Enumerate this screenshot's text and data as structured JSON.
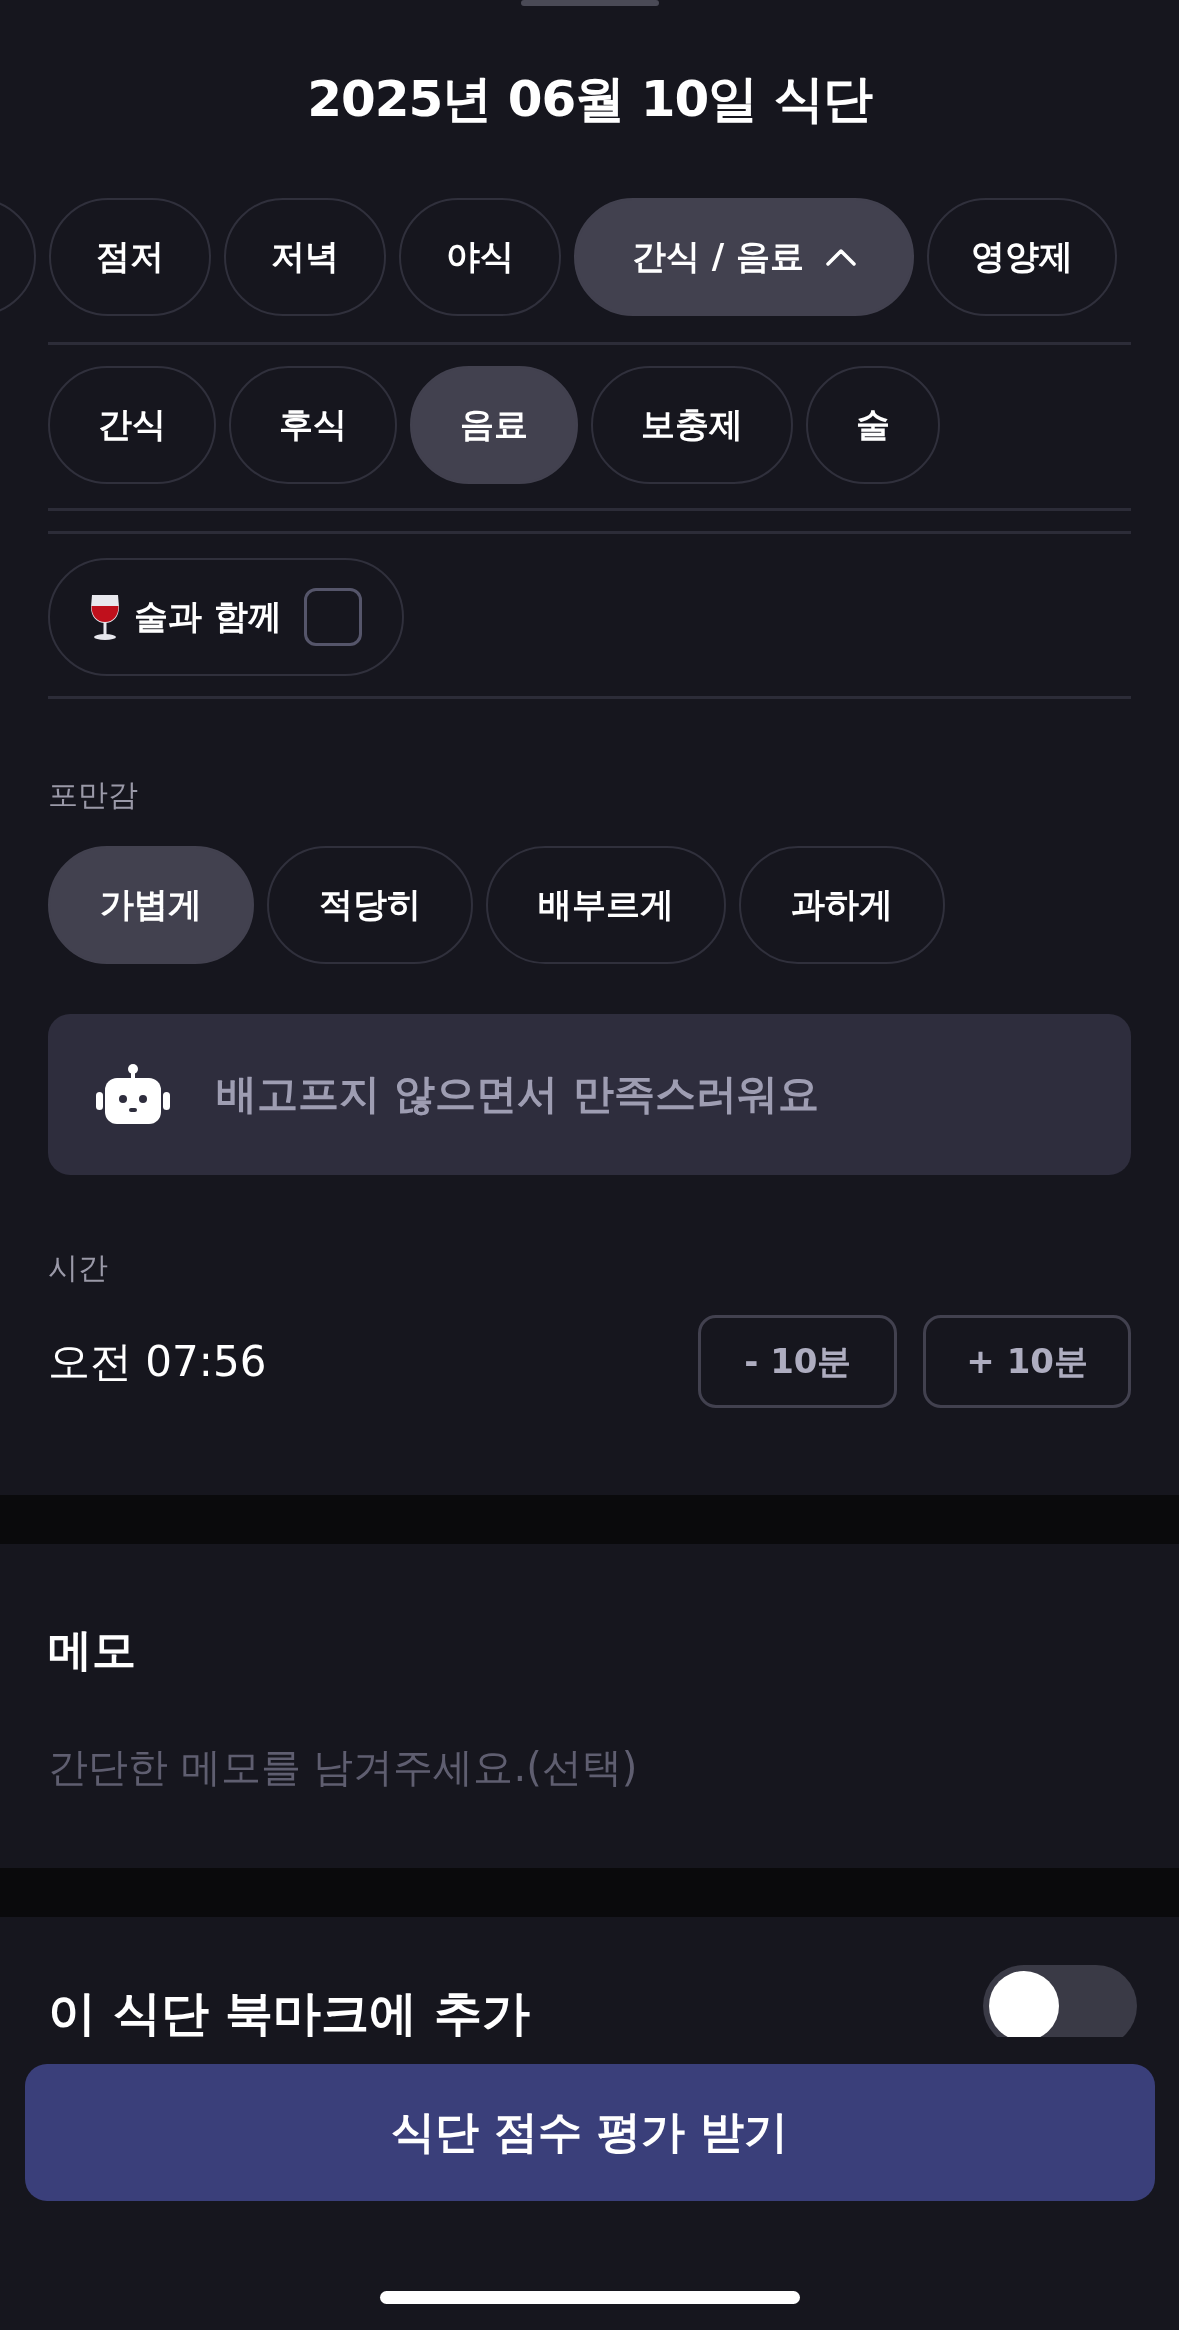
{
  "title": "2025년 06월 10일 식단",
  "meal_types": [
    {
      "label": "점저",
      "selected": false,
      "expanded": false
    },
    {
      "label": "저녁",
      "selected": false,
      "expanded": false
    },
    {
      "label": "야식",
      "selected": false,
      "expanded": false
    },
    {
      "label": "간식 / 음료",
      "selected": true,
      "expanded": true
    },
    {
      "label": "영양제",
      "selected": false,
      "expanded": false
    }
  ],
  "subtypes": [
    {
      "label": "간식",
      "selected": false
    },
    {
      "label": "후식",
      "selected": false
    },
    {
      "label": "음료",
      "selected": true
    },
    {
      "label": "보충제",
      "selected": false
    },
    {
      "label": "술",
      "selected": false
    }
  ],
  "with_alcohol": {
    "label": "술과 함께",
    "checked": false
  },
  "fullness": {
    "label": "포만감",
    "options": [
      {
        "label": "가볍게",
        "selected": true
      },
      {
        "label": "적당히",
        "selected": false
      },
      {
        "label": "배부르게",
        "selected": false
      },
      {
        "label": "과하게",
        "selected": false
      }
    ]
  },
  "ai_comment": "배고프지 않으면서 만족스러워요",
  "time": {
    "label": "시간",
    "value": "오전 07:56",
    "buttons": [
      "- 10분",
      "+ 10분"
    ]
  },
  "memo": {
    "title": "메모",
    "placeholder": "간단한 메모를 남겨주세요.(선택)"
  },
  "bookmark": {
    "label": "이 식단 북마크에 추가",
    "on": false
  },
  "submit": "식단 점수 평가 받기"
}
